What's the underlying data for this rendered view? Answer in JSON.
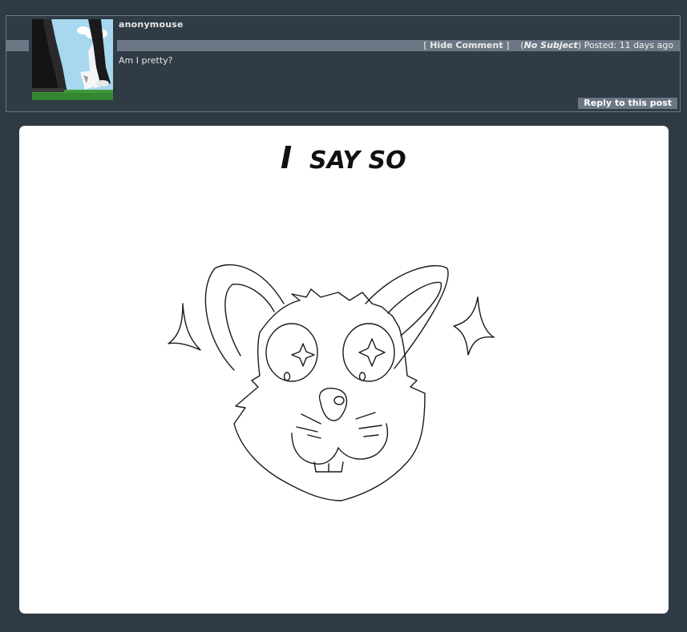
{
  "comment": {
    "username": "anonymouse",
    "actions": {
      "hide_open": "[",
      "hide_label": "Hide Comment",
      "hide_close": "]"
    },
    "subject_open": "(",
    "subject": "No Subject",
    "subject_close": ")",
    "posted_label": "Posted:",
    "posted_time": "11 days ago",
    "body": "Am I pretty?",
    "reply_label": "Reply to this post"
  },
  "image": {
    "caption_big_i": "I",
    "caption_rest": "SAY SO",
    "subject_icon": "mouse-face-drawing"
  },
  "colors": {
    "page_bg": "#2e3a44",
    "bar_bg": "#6b7784",
    "text": "#e6e6e6",
    "panel_bg": "#ffffff"
  }
}
